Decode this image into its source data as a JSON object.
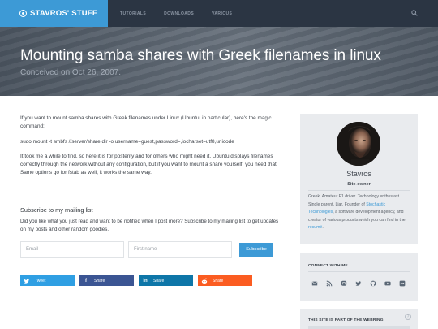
{
  "header": {
    "brand_name": "STAVROS' STUFF",
    "nav": [
      "TUTORIALS",
      "DOWNLOADS",
      "VARIOUS"
    ],
    "search_icon": "search-icon"
  },
  "hero": {
    "title": "Mounting samba shares with Greek filenames in linux",
    "date": "Conceived on Oct 26, 2007."
  },
  "article": {
    "paragraphs": [
      "If you want to mount samba shares with Greek filenames under Linux (Ubuntu, in particular), here's the magic command:",
      "sudo mount -t smbfs //server/share dir -o username=guest,password=,iocharset=utf8,unicode",
      "It took me a while to find, so here it is for posterity and for others who might need it. Ubuntu displays filenames correctly through the network without any configuration, but if you want to mount a share yourself, you need that. Same options go for fstab as well, it works the same way."
    ]
  },
  "mailing_list": {
    "title": "Subscribe to my mailing list",
    "description": "Did you like what you just read and want to be notified when I post more? Subscribe to my mailing list to get updates on my posts and other random goodies.",
    "email_placeholder": "Email",
    "first_name_placeholder": "First name",
    "button_label": "Subscribe"
  },
  "share": {
    "twitter": "Tweet",
    "facebook": "Share",
    "linkedin": "Share",
    "reddit": "Share"
  },
  "sidebar": {
    "owner": {
      "name": "Stavros",
      "role": "Site-owner",
      "bio_pre": "Greek. Amateur F1 driver. Technology enthusiast. Single parent. Liar. Founder of ",
      "bio_link1": "Stochastic Technologies",
      "bio_mid": ", a software development agency, and creator of various products which you can find in the ",
      "bio_link2": "résumé",
      "bio_post": "."
    },
    "connect": {
      "title": "CONNECT WITH ME",
      "icons": [
        "email-icon",
        "rss-icon",
        "mastodon-icon",
        "twitter-icon",
        "github-icon",
        "youtube-icon",
        "flickr-icon"
      ]
    },
    "webring": {
      "title": "THIS SITE IS PART OF THE WEBRING:"
    }
  },
  "colors": {
    "accent": "#3d9ad6",
    "nav_bg": "#2b3543",
    "twitter": "#2f9fe3",
    "facebook": "#3b5593",
    "linkedin": "#0e76a8",
    "reddit": "#fb5c21"
  }
}
